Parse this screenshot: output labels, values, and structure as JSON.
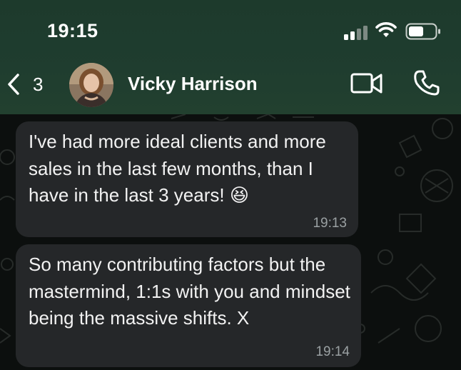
{
  "status_bar": {
    "time": "19:15"
  },
  "header": {
    "back_count": "3",
    "contact_name": "Vicky Harrison"
  },
  "icons": {
    "signal": "cellular-signal-icon",
    "wifi": "wifi-icon",
    "battery": "battery-icon",
    "back": "chevron-left-icon",
    "video": "video-camera-icon",
    "call": "phone-icon"
  },
  "messages": [
    {
      "text": "I've had more ideal clients and more sales in the last few months, than I have in the last 3 years! 😆",
      "time": "19:13"
    },
    {
      "text": "So many contributing factors but the mastermind, 1:1s with you and mindset being the massive shifts. X",
      "time": "19:14"
    }
  ],
  "colors": {
    "header_bg": "#1f3d2f",
    "chat_bg": "#0c0f0e",
    "bubble_bg": "#252729",
    "timestamp": "#9aa0a2"
  }
}
